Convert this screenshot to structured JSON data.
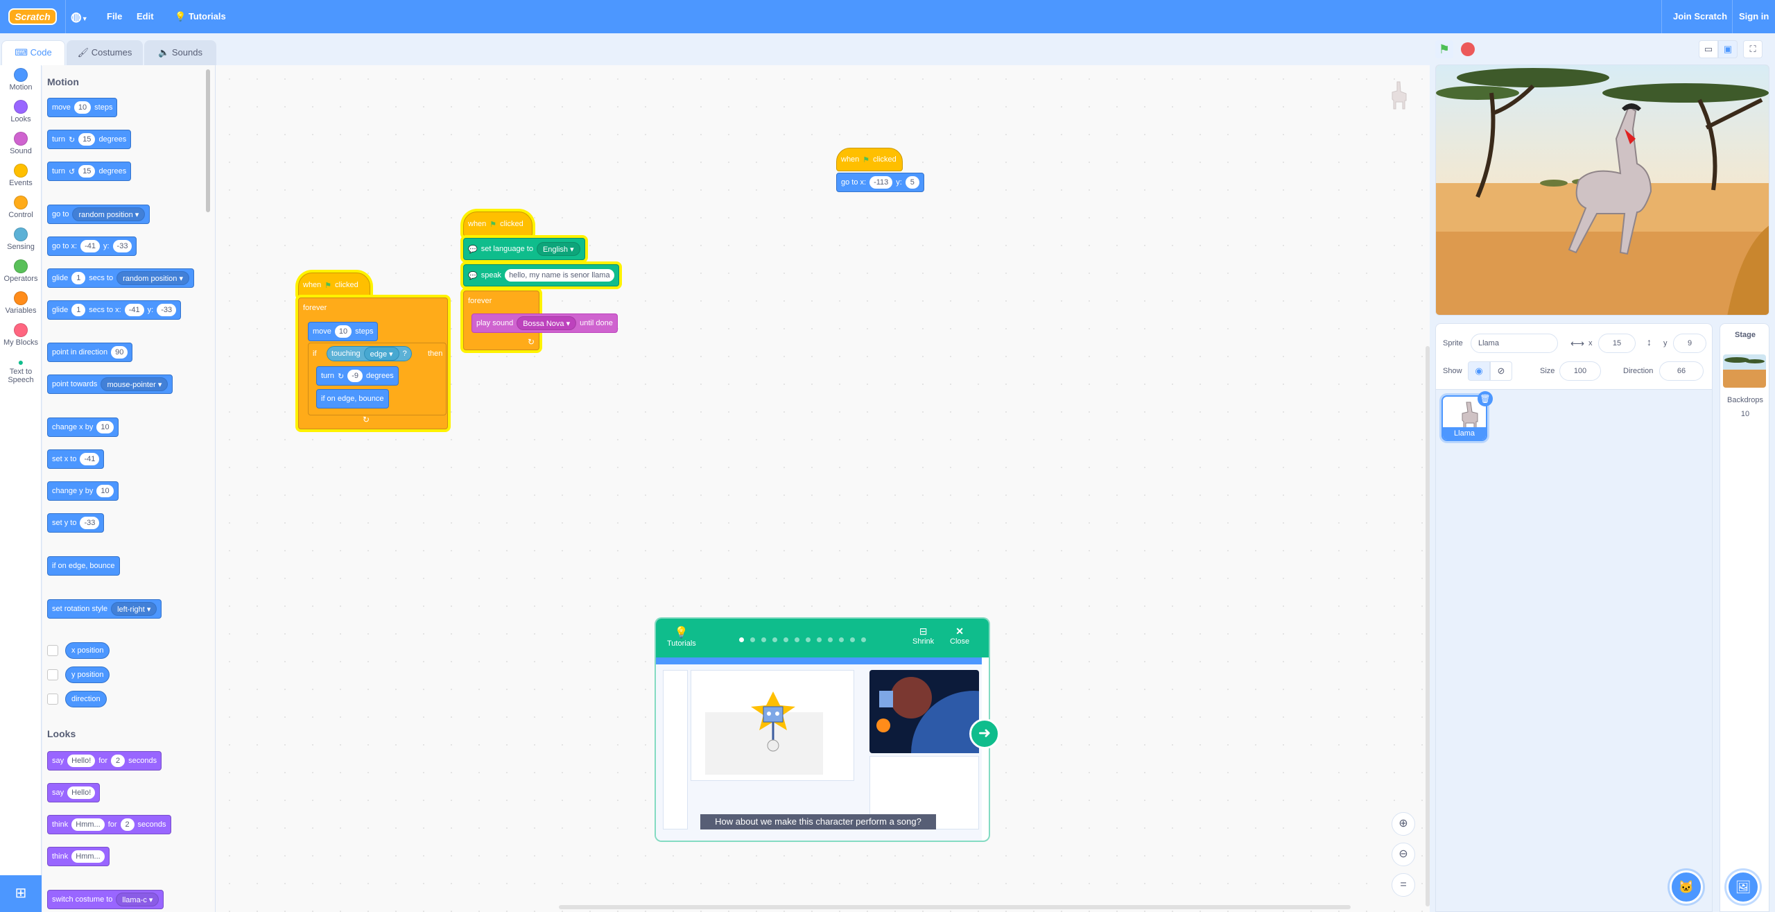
{
  "menubar": {
    "logo": "Scratch",
    "file": "File",
    "edit": "Edit",
    "tutorials": "Tutorials",
    "join": "Join Scratch",
    "signin": "Sign in"
  },
  "tabs": {
    "code": "Code",
    "costumes": "Costumes",
    "sounds": "Sounds"
  },
  "categories": [
    {
      "label": "Motion",
      "color": "#4c97ff"
    },
    {
      "label": "Looks",
      "color": "#9966ff"
    },
    {
      "label": "Sound",
      "color": "#cf63cf"
    },
    {
      "label": "Events",
      "color": "#ffbf00"
    },
    {
      "label": "Control",
      "color": "#ffab19"
    },
    {
      "label": "Sensing",
      "color": "#5cb1d6"
    },
    {
      "label": "Operators",
      "color": "#59c059"
    },
    {
      "label": "Variables",
      "color": "#ff8c1a"
    },
    {
      "label": "My Blocks",
      "color": "#ff6680"
    },
    {
      "label": "Text to Speech",
      "color": "#0fbd8c"
    }
  ],
  "palette": {
    "motion_heading": "Motion",
    "looks_heading": "Looks",
    "move": {
      "a": "move",
      "v": "10",
      "b": "steps"
    },
    "turn_r": {
      "a": "turn",
      "v": "15",
      "b": "degrees"
    },
    "turn_l": {
      "a": "turn",
      "v": "15",
      "b": "degrees"
    },
    "goto": {
      "a": "go to",
      "dd": "random position"
    },
    "gotoxy": {
      "a": "go to x:",
      "x": "-41",
      "yl": "y:",
      "y": "-33"
    },
    "glide": {
      "a": "glide",
      "v": "1",
      "b": "secs to",
      "dd": "random position"
    },
    "glidexy": {
      "a": "glide",
      "v": "1",
      "b": "secs to x:",
      "x": "-41",
      "yl": "y:",
      "y": "-33"
    },
    "point_dir": {
      "a": "point in direction",
      "v": "90"
    },
    "point_towards": {
      "a": "point towards",
      "dd": "mouse-pointer"
    },
    "change_x": {
      "a": "change x by",
      "v": "10"
    },
    "set_x": {
      "a": "set x to",
      "v": "-41"
    },
    "change_y": {
      "a": "change y by",
      "v": "10"
    },
    "set_y": {
      "a": "set y to",
      "v": "-33"
    },
    "bounce": "if on edge, bounce",
    "rot_style": {
      "a": "set rotation style",
      "dd": "left-right"
    },
    "xpos": "x position",
    "ypos": "y position",
    "direction": "direction",
    "say_for": {
      "a": "say",
      "v": "Hello!",
      "b": "for",
      "n": "2",
      "c": "seconds"
    },
    "say": {
      "a": "say",
      "v": "Hello!"
    },
    "think_for": {
      "a": "think",
      "v": "Hmm...",
      "b": "for",
      "n": "2",
      "c": "seconds"
    },
    "think": {
      "a": "think",
      "v": "Hmm..."
    },
    "switch_costume": {
      "a": "switch costume to",
      "dd": "llama-c"
    }
  },
  "scripts": {
    "s1": {
      "when": "when",
      "clicked": "clicked",
      "forever": "forever",
      "move": "move",
      "move_v": "10",
      "steps": "steps",
      "if": "if",
      "touching": "touching",
      "edge": "edge",
      "q": "?",
      "then": "then",
      "turn": "turn",
      "turn_v": "-9",
      "degrees": "degrees",
      "bounce": "if on edge, bounce"
    },
    "s2": {
      "when": "when",
      "clicked": "clicked",
      "set_lang": "set language to",
      "lang": "English",
      "speak": "speak",
      "speak_v": "hello, my name is senor llama",
      "forever": "forever",
      "play": "play sound",
      "sound": "Bossa Nova",
      "until": "until done"
    },
    "s3": {
      "when": "when",
      "clicked": "clicked",
      "goto": "go to x:",
      "x": "-113",
      "yl": "y:",
      "y": "5"
    }
  },
  "sprite_info": {
    "sprite_label": "Sprite",
    "sprite_name": "Llama",
    "x_label": "x",
    "x": "15",
    "y_label": "y",
    "y": "9",
    "show": "Show",
    "size_label": "Size",
    "size": "100",
    "dir_label": "Direction",
    "dir": "66"
  },
  "sprites": [
    {
      "name": "Llama"
    }
  ],
  "stage_pane": {
    "title": "Stage",
    "backdrops_label": "Backdrops",
    "backdrops": "10"
  },
  "tutorial": {
    "label": "Tutorials",
    "shrink": "Shrink",
    "close": "Close",
    "caption": "How about we make this character perform a song?",
    "steps": 12,
    "current_step": 1
  },
  "colors": {
    "menubar": "#4c97ff",
    "tutorial": "#0fbd8c",
    "glow": "#fff200"
  }
}
